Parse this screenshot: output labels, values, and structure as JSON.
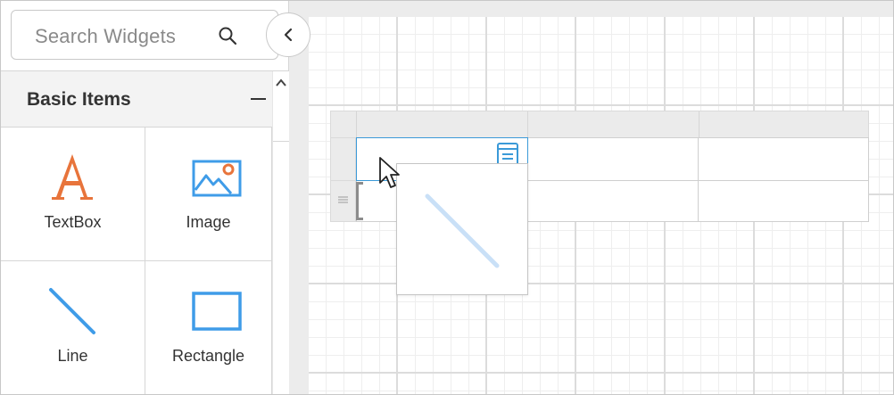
{
  "search": {
    "placeholder": "Search Widgets",
    "icon": "search-icon"
  },
  "panel": {
    "toggle_icon": "chevron-left-icon"
  },
  "section": {
    "title": "Basic Items",
    "collapse_icon": "minus-icon"
  },
  "widgets": [
    {
      "label": "TextBox",
      "icon": "textbox-icon"
    },
    {
      "label": "Image",
      "icon": "image-icon"
    },
    {
      "label": "Line",
      "icon": "line-icon"
    },
    {
      "label": "Rectangle",
      "icon": "rectangle-icon"
    }
  ],
  "colors": {
    "textbox_accent": "#e8743b",
    "widget_blue": "#3f9ce8",
    "selection_blue": "#3b9ad8"
  },
  "table": {
    "columns": 3,
    "rows": 2
  },
  "drag": {
    "widget": "Line",
    "preview_icon": "line-icon"
  }
}
